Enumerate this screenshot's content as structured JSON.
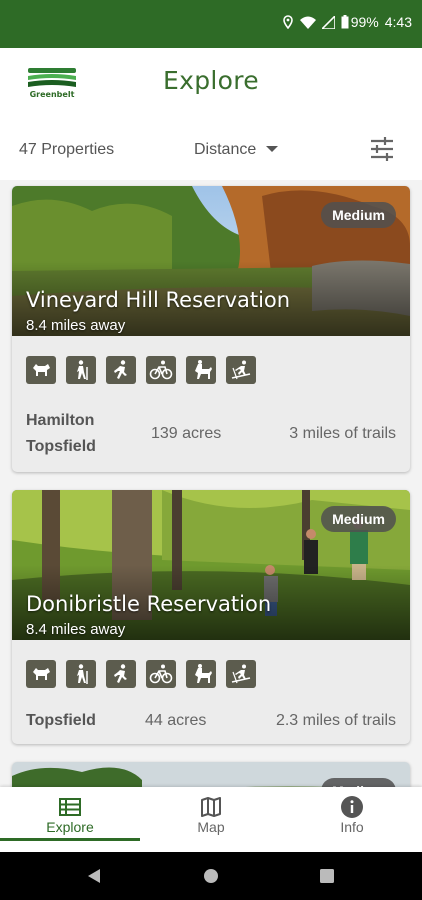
{
  "status_bar": {
    "battery": "99%",
    "time": "4:43"
  },
  "header": {
    "logo_text": "Greenbelt",
    "title": "Explore"
  },
  "toolbar": {
    "count": "47 Properties",
    "sort_label": "Distance"
  },
  "properties": [
    {
      "name": "Vineyard Hill Reservation",
      "distance": "8.4 miles away",
      "difficulty": "Medium",
      "towns": [
        "Hamilton",
        "Topsfield"
      ],
      "acres": "139 acres",
      "trails": "3 miles of trails",
      "activities": [
        "dog-icon",
        "hiking-icon",
        "running-icon",
        "biking-icon",
        "horseback-icon",
        "skiing-icon"
      ]
    },
    {
      "name": "Donibristle Reservation",
      "distance": "8.4 miles away",
      "difficulty": "Medium",
      "towns": [
        "Topsfield"
      ],
      "acres": "44 acres",
      "trails": "2.3 miles of trails",
      "activities": [
        "dog-icon",
        "hiking-icon",
        "running-icon",
        "biking-icon",
        "horseback-icon",
        "skiing-icon"
      ]
    },
    {
      "difficulty": "Medium"
    }
  ],
  "bottom_nav": {
    "items": [
      {
        "label": "Explore",
        "icon": "list-icon"
      },
      {
        "label": "Map",
        "icon": "map-icon"
      },
      {
        "label": "Info",
        "icon": "info-icon"
      }
    ]
  },
  "colors": {
    "brand_green": "#2e6b26",
    "icon_bg": "#5c5c4e"
  }
}
